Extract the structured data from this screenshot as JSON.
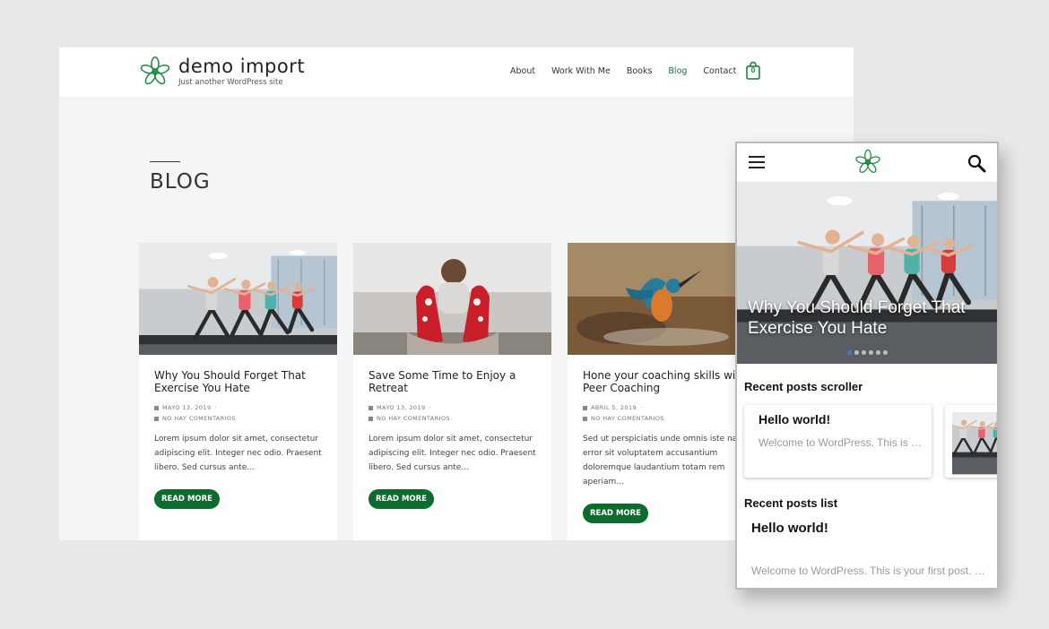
{
  "colors": {
    "accent": "#0e6b2e",
    "nav_active": "#0e7a34",
    "page_bg": "#e9e9e9",
    "content_bg": "#f5f5f5"
  },
  "desktop": {
    "site_title": "demo import",
    "tagline": "Just another WordPress site",
    "nav": [
      "About",
      "Work With Me",
      "Books",
      "Blog",
      "Contact"
    ],
    "nav_active_index": 3,
    "cart_count": "0",
    "page_heading": "BLOG",
    "posts": [
      {
        "title": "Why You Should Forget That Exercise You Hate",
        "date": "MAYO 13, 2019",
        "date_suffix": "·",
        "comments": "NO HAY COMENTARIOS",
        "excerpt": "Lorem ipsum dolor sit amet, consectetur adipiscing elit. Integer nec odio. Praesent libero. Sed cursus ante…",
        "button": "READ MORE",
        "image": "yoga-class"
      },
      {
        "title": "Save Some Time to Enjoy a Retreat",
        "date": "MAYO 13, 2019",
        "date_suffix": "·",
        "comments": "NO HAY COMENTARIOS",
        "excerpt": "Lorem ipsum dolor sit amet, consectetur adipiscing elit. Integer nec odio. Praesent libero. Sed cursus ante…",
        "button": "READ MORE",
        "image": "cozy-socks"
      },
      {
        "title": "Hone your coaching skills with Peer Coaching",
        "date": "ABRIL 5, 2019",
        "date_suffix": "·",
        "comments": "NO HAY COMENTARIOS",
        "excerpt": "Sed ut perspiciatis unde omnis iste natus error sit voluptatem accusantium doloremque laudantium totam rem aperiam…",
        "button": "READ MORE",
        "image": "kingfisher"
      }
    ]
  },
  "mobile": {
    "hero_title": "Why You Should Forget That Exercise You Hate",
    "slider_dot_count": 6,
    "slider_active_index": 0,
    "scroller_heading": "Recent posts scroller",
    "scroller_card": {
      "title": "Hello world!",
      "excerpt": "Welcome to WordPress. This is your first post."
    },
    "list_heading": "Recent posts list",
    "list_item": {
      "title": "Hello world!",
      "excerpt": "Welcome to WordPress. This is your first post. Edit or delete it, then start writing!"
    }
  }
}
